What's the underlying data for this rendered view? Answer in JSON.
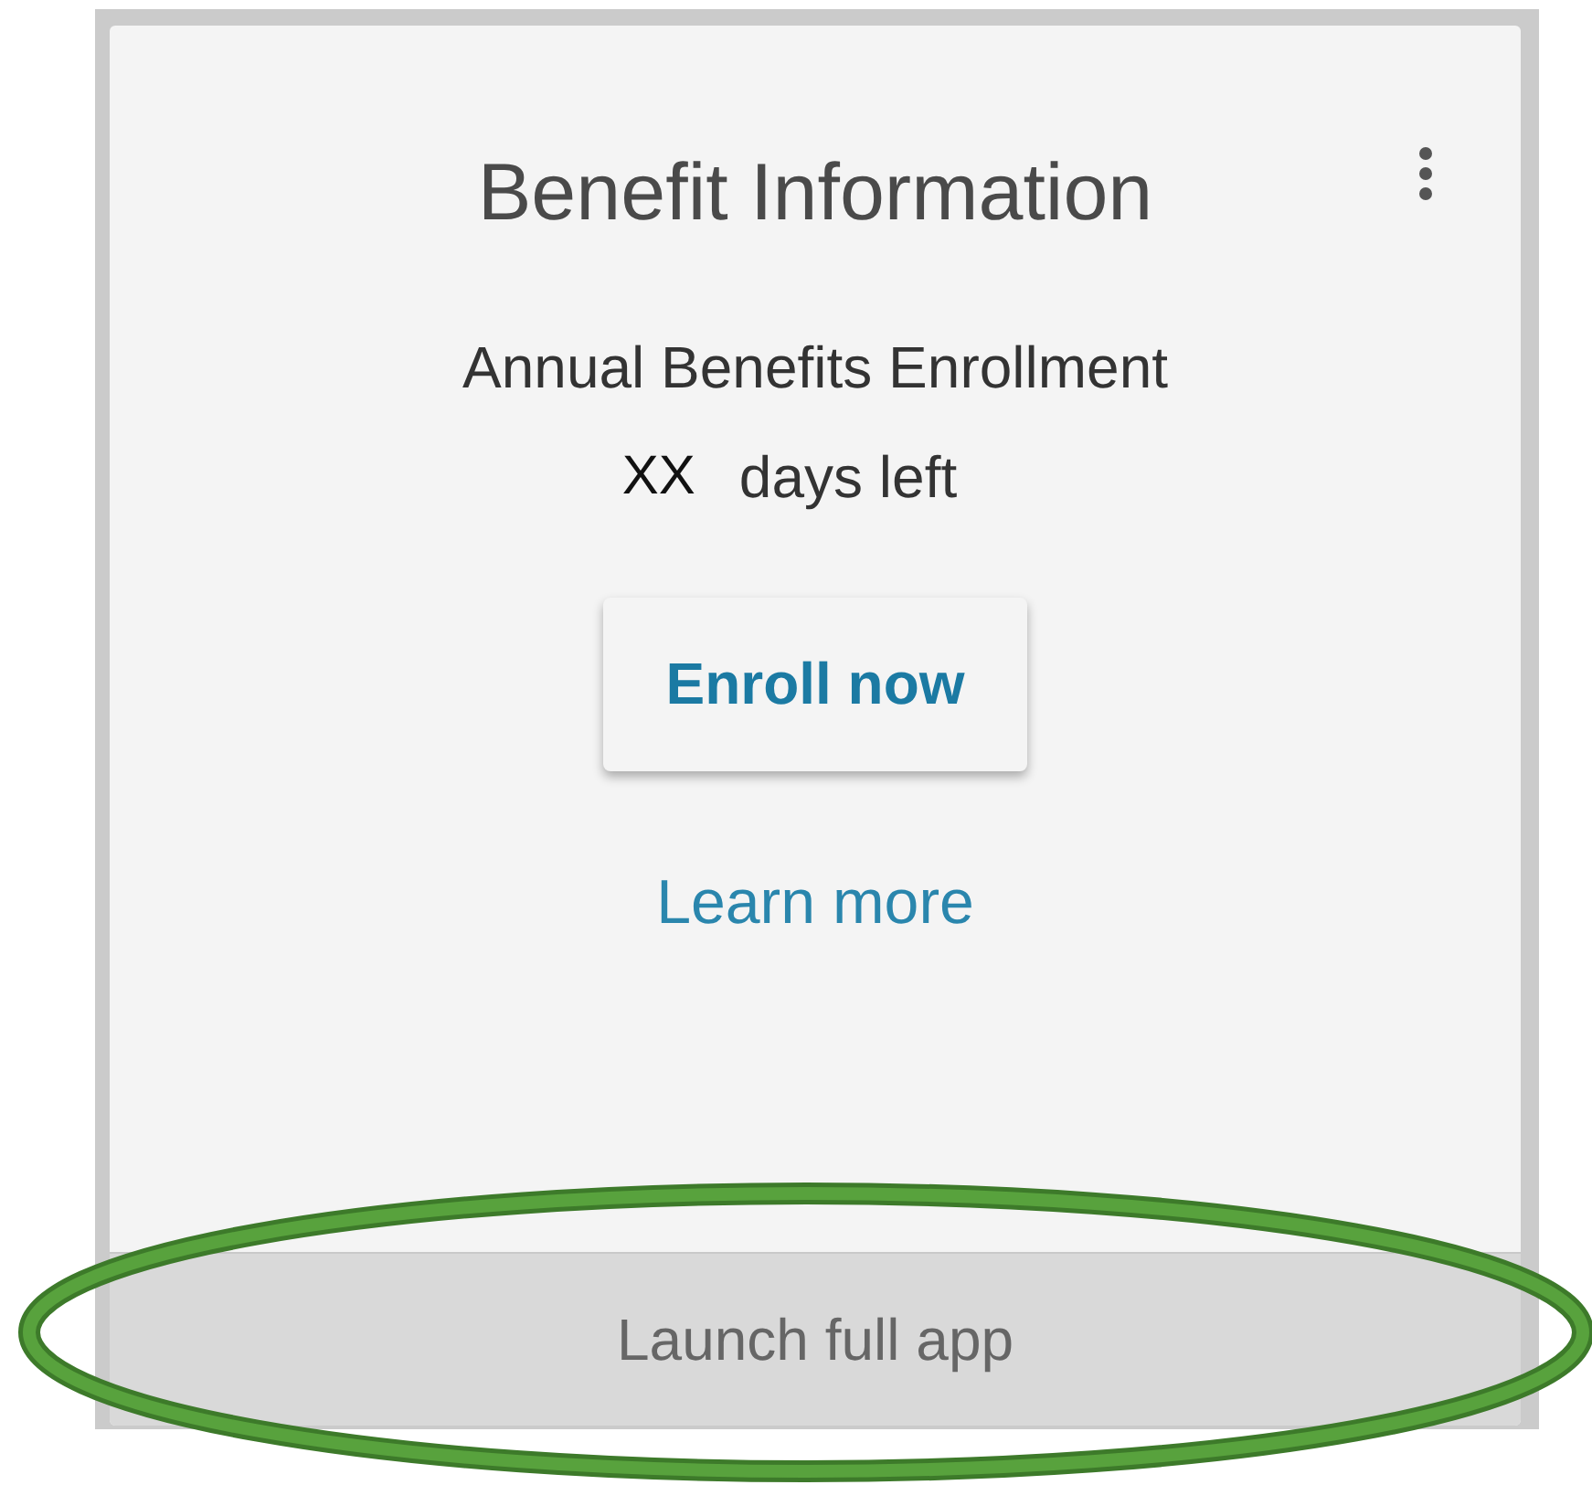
{
  "card": {
    "title": "Benefit Information",
    "subtitle": "Annual Benefits Enrollment",
    "countdown": {
      "count": "XX",
      "label": "days left"
    },
    "primary_button": "Enroll now",
    "link": "Learn more",
    "footer_action": "Launch full app"
  }
}
